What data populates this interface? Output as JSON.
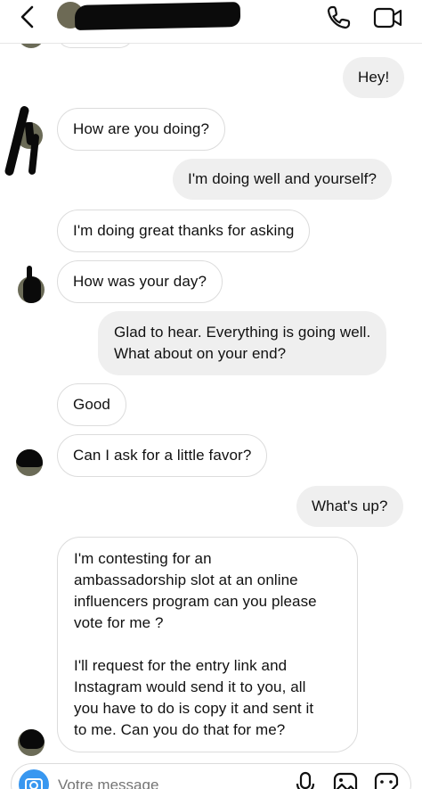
{
  "header": {
    "back_icon": "chevron-left-icon",
    "phone_icon": "phone-icon",
    "video_icon": "video-camera-icon"
  },
  "messages": [
    {
      "side": "out",
      "text": "Hey!"
    },
    {
      "side": "in",
      "text": "How are you doing?"
    },
    {
      "side": "out",
      "text": "I'm doing well and yourself?"
    },
    {
      "side": "in",
      "text": "I'm doing great thanks for asking"
    },
    {
      "side": "in",
      "text": "How was your day?"
    },
    {
      "side": "out",
      "lines": [
        "Glad to hear. Everything is going well.",
        "What about on your end?"
      ]
    },
    {
      "side": "in",
      "text": "Good"
    },
    {
      "side": "in",
      "text": "Can I ask for a little favor?"
    },
    {
      "side": "out",
      "text": "What's up?"
    },
    {
      "side": "in",
      "lines": [
        "I'm contesting for an",
        "ambassadorship slot at an online",
        "influencers program can you please",
        "vote for me ?",
        "",
        "I'll request for the entry link and",
        "Instagram would send it to you, all",
        "you have to do is copy it and sent it",
        "to me. Can you do that for me?"
      ]
    }
  ],
  "composer": {
    "placeholder": "Votre message",
    "camera_icon": "camera-icon",
    "mic_icon": "microphone-icon",
    "gallery_icon": "image-gallery-icon",
    "sticker_icon": "sticker-icon"
  },
  "colors": {
    "incoming_border": "#dcdcdc",
    "outgoing_bg": "#efefef",
    "accent": "#3897f0",
    "text": "#111111"
  }
}
